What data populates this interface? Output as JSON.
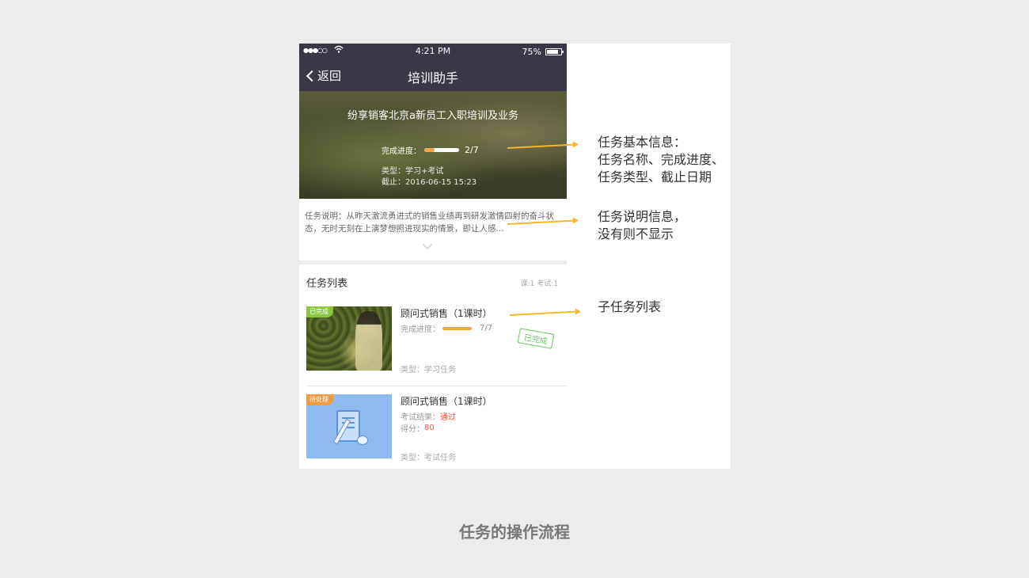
{
  "statusbar": {
    "time": "4:21 PM",
    "battery": "75%",
    "signal": "●●●○○",
    "wifi": ""
  },
  "navbar": {
    "back_label": "返回",
    "title": "培训助手"
  },
  "hero": {
    "task_name": "纷享销客北京a新员工入职培训及业务",
    "progress_label": "完成进度：",
    "progress_count": "2/7",
    "progress_fraction": 0.29,
    "type_text": "类型：学习+考试",
    "deadline_text": "截止：2016-06-15 15:23"
  },
  "description": {
    "text": "任务说明：从昨天激流勇进式的销售业绩再到研发激情四射的奋斗状态，无时无刻在上演梦想照进现实的情景，即让人感..."
  },
  "task_list": {
    "header": "任务列表",
    "counts": "课:1  考试:1",
    "items": [
      {
        "tag": "已完成",
        "name": "顾问式销售（1课时）",
        "progress_label": "完成进度：",
        "progress_count": "7/7",
        "type": "类型：学习任务",
        "stamp": "已完成"
      },
      {
        "tag": "待处理",
        "name": "顾问式销售（1课时）",
        "result_label": "考试结果：",
        "result_value": "通过",
        "score_label": "得分：",
        "score_value": "80",
        "type": "类型：考试任务"
      }
    ]
  },
  "callouts": {
    "basic_info": [
      "任务基本信息：",
      "任务名称、完成进度、",
      "任务类型、截止日期"
    ],
    "description_info": [
      "任务说明信息，",
      "没有则不显示"
    ],
    "subtask_list": [
      "子任务列表"
    ]
  },
  "caption": "任务的操作流程",
  "colors": {
    "nav_bg": "#3a3847",
    "accent_orange": "#f0a64a",
    "arrow": "#f5b82e",
    "done_green": "#8cc63f",
    "pending_orange": "#f39a3c",
    "red": "#ef4f3a"
  }
}
